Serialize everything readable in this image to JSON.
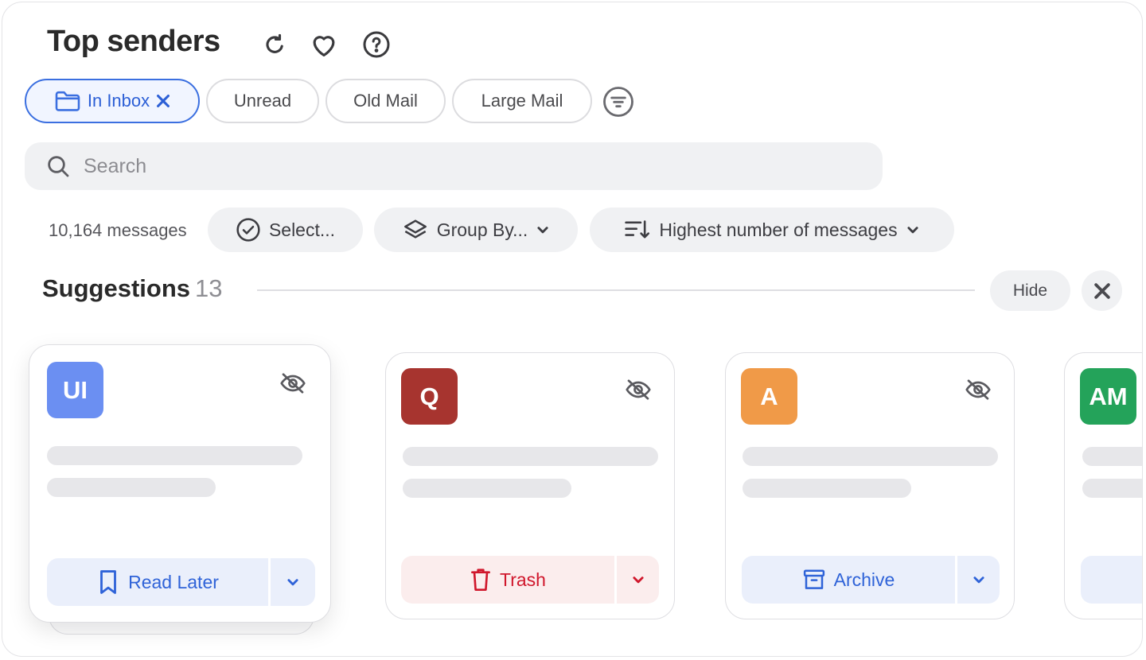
{
  "header": {
    "title": "Top senders",
    "icons": [
      "refresh-icon",
      "heart-icon",
      "help-icon"
    ]
  },
  "filters": {
    "chips": [
      {
        "label": "In Inbox",
        "active": true,
        "icon": "folder-icon"
      },
      {
        "label": "Unread",
        "active": false
      },
      {
        "label": "Old Mail",
        "active": false
      },
      {
        "label": "Large Mail",
        "active": false
      }
    ],
    "filter_icon": "filter-icon"
  },
  "search": {
    "placeholder": "Search",
    "value": ""
  },
  "toolbar": {
    "count": "10,164 messages",
    "select_label": "Select...",
    "group_by_label": "Group By...",
    "sort_label": "Highest number of messages"
  },
  "suggestions": {
    "title": "Suggestions",
    "count": "13",
    "hide_label": "Hide",
    "cards": [
      {
        "initials": "UI",
        "color": "#6b8ff2",
        "action": "Read Later",
        "action_icon": "bookmark-icon",
        "tone": "blue"
      },
      {
        "initials": "Q",
        "color": "#a7342f",
        "action": "Trash",
        "action_icon": "trash-icon",
        "tone": "red"
      },
      {
        "initials": "A",
        "color": "#f09a48",
        "action": "Archive",
        "action_icon": "archive-icon",
        "tone": "blue"
      },
      {
        "initials": "AM",
        "color": "#24a35a",
        "action": "",
        "action_icon": "bookmark-icon",
        "tone": "blue"
      }
    ]
  },
  "colors": {
    "accent": "#3b6fe0",
    "danger": "#d0172c",
    "chip_border": "#dcdcdf",
    "surface": "#f0f1f3"
  }
}
